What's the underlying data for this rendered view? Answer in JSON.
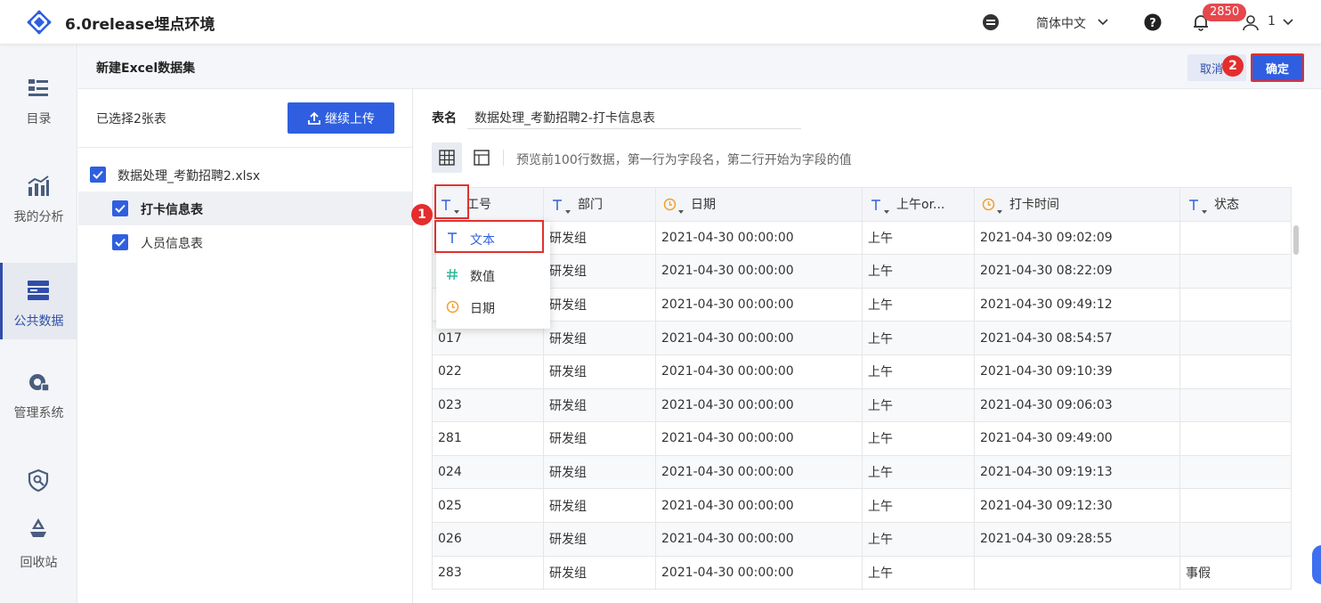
{
  "app": {
    "title": "6.0release埋点环境"
  },
  "topbar": {
    "language": "简体中文",
    "notification_count": "2850",
    "user": "1"
  },
  "nav": {
    "items": [
      {
        "label": "目录",
        "icon": "catalog-icon"
      },
      {
        "label": "我的分析",
        "icon": "chart-icon"
      },
      {
        "label": "公共数据",
        "icon": "database-icon"
      },
      {
        "label": "管理系统",
        "icon": "gear-icon"
      },
      {
        "label": "",
        "icon": "shield-icon"
      },
      {
        "label": "回收站",
        "icon": "recycle-icon"
      }
    ]
  },
  "header": {
    "title": "新建Excel数据集",
    "cancel_label": "取消",
    "ok_label": "确定"
  },
  "left": {
    "selected_text": "已选择2张表",
    "upload_label": "继续上传",
    "file_name": "数据处理_考勤招聘2.xlsx",
    "sheets": [
      "打卡信息表",
      "人员信息表"
    ]
  },
  "right": {
    "name_label": "表名",
    "name_value": "数据处理_考勤招聘2-打卡信息表",
    "hint": "预览前100行数据，第一行为字段名，第二行开始为字段的值"
  },
  "steps": [
    "1",
    "2"
  ],
  "dropdown": {
    "items": [
      {
        "label": "文本",
        "icon": "text-type-icon"
      },
      {
        "label": "数值",
        "icon": "number-type-icon"
      },
      {
        "label": "日期",
        "icon": "date-type-icon"
      }
    ]
  },
  "table": {
    "columns": [
      {
        "name": "工号",
        "type": "text"
      },
      {
        "name": "部门",
        "type": "text"
      },
      {
        "name": "日期",
        "type": "date"
      },
      {
        "name": "上午or...",
        "type": "text"
      },
      {
        "name": "打卡时间",
        "type": "date"
      },
      {
        "name": "状态",
        "type": "text"
      }
    ],
    "rows": [
      [
        "",
        "研发组",
        "2021-04-30 00:00:00",
        "上午",
        "2021-04-30 09:02:09",
        ""
      ],
      [
        "",
        "研发组",
        "2021-04-30 00:00:00",
        "上午",
        "2021-04-30 08:22:09",
        ""
      ],
      [
        "",
        "研发组",
        "2021-04-30 00:00:00",
        "上午",
        "2021-04-30 09:49:12",
        ""
      ],
      [
        "017",
        "研发组",
        "2021-04-30 00:00:00",
        "上午",
        "2021-04-30 08:54:57",
        ""
      ],
      [
        "022",
        "研发组",
        "2021-04-30 00:00:00",
        "上午",
        "2021-04-30 09:10:39",
        ""
      ],
      [
        "023",
        "研发组",
        "2021-04-30 00:00:00",
        "上午",
        "2021-04-30 09:06:03",
        ""
      ],
      [
        "281",
        "研发组",
        "2021-04-30 00:00:00",
        "上午",
        "2021-04-30 09:49:00",
        ""
      ],
      [
        "024",
        "研发组",
        "2021-04-30 00:00:00",
        "上午",
        "2021-04-30 09:19:13",
        ""
      ],
      [
        "025",
        "研发组",
        "2021-04-30 00:00:00",
        "上午",
        "2021-04-30 09:12:30",
        ""
      ],
      [
        "026",
        "研发组",
        "2021-04-30 00:00:00",
        "上午",
        "2021-04-30 09:28:55",
        ""
      ],
      [
        "283",
        "研发组",
        "2021-04-30 00:00:00",
        "上午",
        "",
        "事假"
      ]
    ]
  },
  "colors": {
    "primary": "#2f5fe0",
    "highlight": "#e03131",
    "date_icon": "#f0a030",
    "number_icon": "#2cb89a"
  }
}
